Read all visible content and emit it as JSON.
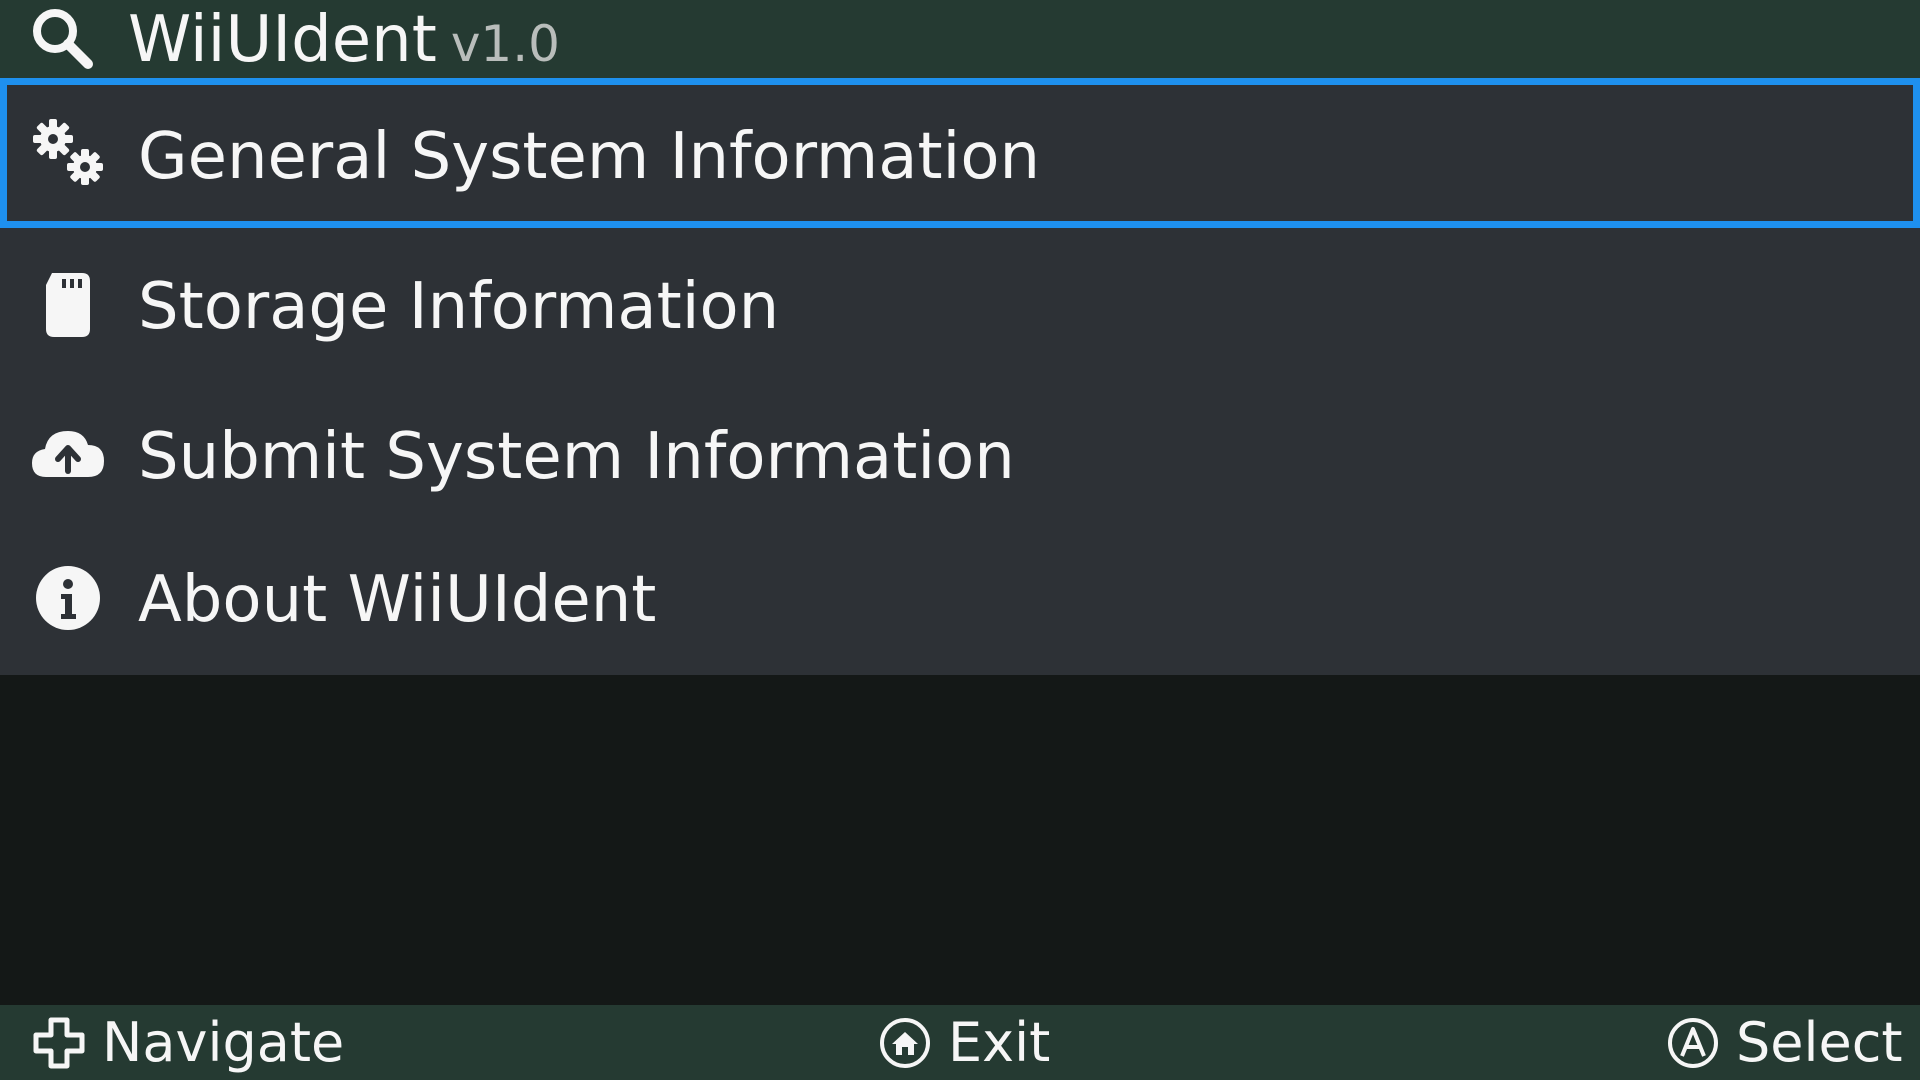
{
  "header": {
    "app_name": "WiiUIdent",
    "version": "v1.0",
    "icon": "search-icon"
  },
  "menu": {
    "selected_index": 0,
    "items": [
      {
        "label": "General System Information",
        "icon": "gears-icon"
      },
      {
        "label": "Storage Information",
        "icon": "sd-card-icon"
      },
      {
        "label": "Submit System Information",
        "icon": "cloud-upload-icon"
      },
      {
        "label": "About WiiUIdent",
        "icon": "info-icon"
      }
    ]
  },
  "footer": {
    "navigate": {
      "label": "Navigate",
      "icon": "dpad-icon"
    },
    "exit": {
      "label": "Exit",
      "icon": "home-button-icon"
    },
    "select": {
      "label": "Select",
      "icon": "a-button-icon"
    }
  },
  "colors": {
    "header_bg": "#253a32",
    "menu_bg": "#2d3136",
    "selection_border": "#1e90ee",
    "empty_bg": "#141817",
    "text": "#f6f6f6"
  }
}
